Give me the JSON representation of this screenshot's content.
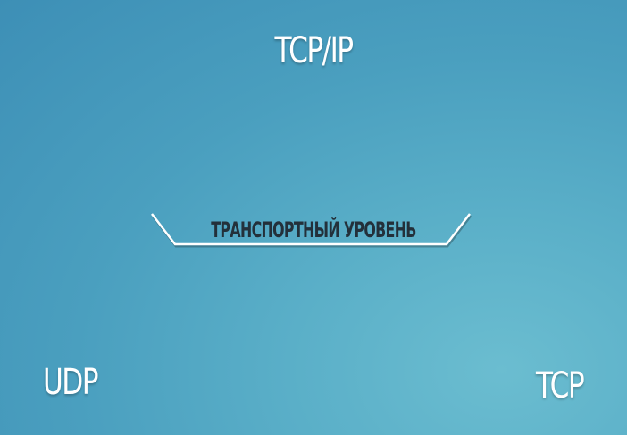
{
  "slide": {
    "title": "TCP/IP",
    "layer_label": "ТРАНСПОРТНЫЙ УРОВЕНЬ",
    "protocols": {
      "left": "UDP",
      "right": "TCP"
    }
  },
  "colors": {
    "background_light": "#6bbdd0",
    "background_dark": "#3d8fb6",
    "text_primary": "#ffffff",
    "text_dark": "#23303a"
  }
}
